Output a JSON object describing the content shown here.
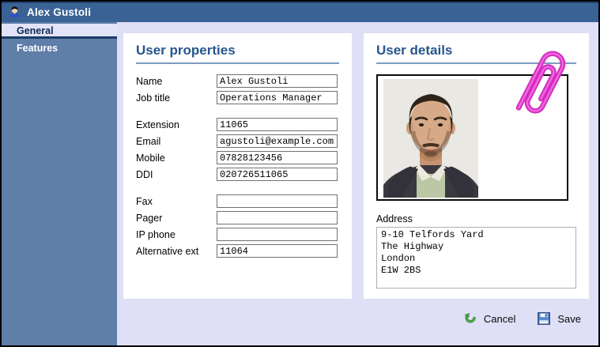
{
  "window": {
    "title": "Alex Gustoli"
  },
  "sidebar": {
    "items": [
      {
        "label": "General",
        "selected": true
      },
      {
        "label": "Features",
        "selected": false
      }
    ]
  },
  "user_properties": {
    "title": "User properties",
    "fields": [
      {
        "label": "Name",
        "value": "Alex Gustoli"
      },
      {
        "label": "Job title",
        "value": "Operations Manager"
      },
      {
        "label": "Extension",
        "value": "11065"
      },
      {
        "label": "Email",
        "value": "agustoli@example.com"
      },
      {
        "label": "Mobile",
        "value": "07828123456"
      },
      {
        "label": "DDI",
        "value": "020726511065"
      },
      {
        "label": "Fax",
        "value": ""
      },
      {
        "label": "Pager",
        "value": ""
      },
      {
        "label": "IP phone",
        "value": ""
      },
      {
        "label": "Alternative ext",
        "value": "11064"
      }
    ]
  },
  "user_details": {
    "title": "User details",
    "photo_alt": "head-and-shoulders photo of man in dark suit",
    "address_label": "Address",
    "address_value": "9-10 Telfords Yard\nThe Highway\nLondon\nE1W 2BS"
  },
  "actions": {
    "cancel_label": "Cancel",
    "save_label": "Save"
  },
  "colors": {
    "titlebar": "#3b6294",
    "sidebar": "#5f7ea8",
    "selected_tab_bg": "#e2e2f8",
    "content_bg": "#dfdff6",
    "header_text": "#26568c",
    "rule": "#7e9cc0",
    "paperclip": "#e23ad0",
    "cancel_green": "#3da03d",
    "save_blue": "#5c88cf"
  }
}
